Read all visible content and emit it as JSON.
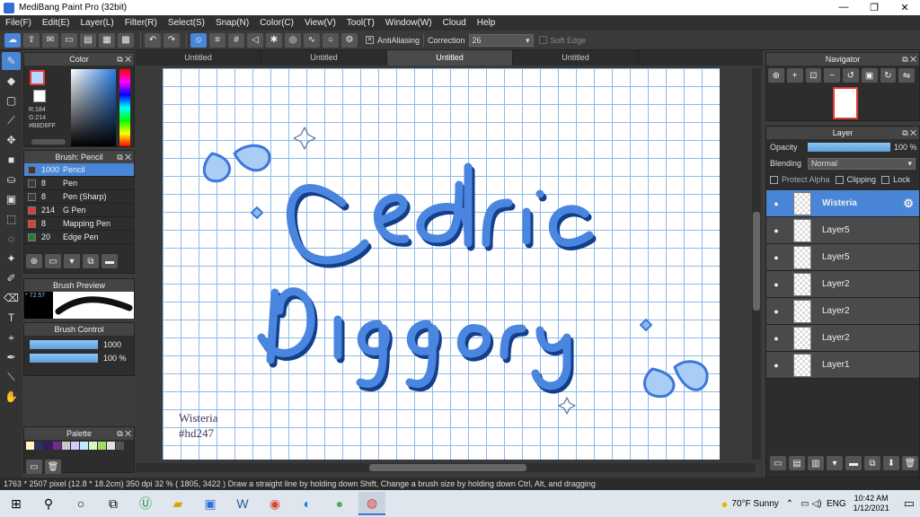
{
  "window": {
    "title": "MediBang Paint Pro (32bit)"
  },
  "menu": [
    "File(F)",
    "Edit(E)",
    "Layer(L)",
    "Filter(R)",
    "Select(S)",
    "Snap(N)",
    "Color(C)",
    "View(V)",
    "Tool(T)",
    "Window(W)",
    "Cloud",
    "Help"
  ],
  "toolbar": {
    "antialias_label": "AntiAliasing",
    "correction_label": "Correction",
    "correction_value": "26",
    "soft_edge_label": "Soft Edge"
  },
  "tabs": [
    "Untitled",
    "Untitled",
    "Untitled",
    "Untitled"
  ],
  "color_panel": {
    "title": "Color",
    "r": "R:184",
    "g": "G:214",
    "hex": "#B8D6FF",
    "foreground": "#b8d6ff"
  },
  "brush_panel": {
    "title": "Brush: Pencil",
    "items": [
      {
        "size": "1000",
        "name": "Pencil",
        "color": "#3a3a3a"
      },
      {
        "size": "8",
        "name": "Pen",
        "color": "#3a3a3a"
      },
      {
        "size": "8",
        "name": "Pen (Sharp)",
        "color": "#3a3a3a"
      },
      {
        "size": "214",
        "name": "G Pen",
        "color": "#e53935"
      },
      {
        "size": "8",
        "name": "Mapping Pen",
        "color": "#e53935"
      },
      {
        "size": "20",
        "name": "Edge Pen",
        "color": "#2e7d32"
      }
    ]
  },
  "preview_panel": {
    "title": "Brush Preview",
    "size": "72.57"
  },
  "control_panel": {
    "title": "Brush Control",
    "size_value": "1000",
    "opacity_value": "100 %",
    "size_fill": 1.0,
    "opacity_fill": 1.0
  },
  "palette_panel": {
    "title": "Palette",
    "colors": [
      "#fff7c2",
      "#2d2d6a",
      "#3a1a5a",
      "#6b2d8f",
      "#c7c7c7",
      "#d9c7ff",
      "#c2e7ff",
      "#d4f5c7",
      "#a5d86a",
      "#e2e2e2",
      "#555555",
      "#2b2b2b"
    ]
  },
  "canvas": {
    "signature_line1": "Wisteria",
    "signature_line2": "#hd247"
  },
  "navigator": {
    "title": "Navigator"
  },
  "layer_panel": {
    "title": "Layer",
    "opacity_label": "Opacity",
    "opacity_value": "100 %",
    "blending_label": "Blending",
    "blending_value": "Normal",
    "protect_alpha": "Protect Alpha",
    "clipping": "Clipping",
    "lock": "Lock",
    "layers": [
      "Wisteria",
      "Layer5",
      "Layer5",
      "Layer2",
      "Layer2",
      "Layer2",
      "Layer1"
    ]
  },
  "status": "1763 * 2507 pixel  (12.8 * 18.2cm)  350 dpi  32 %  ( 1805, 3422 )  Draw a straight line by holding down Shift, Change a brush size by holding down Ctrl, Alt, and dragging",
  "taskbar": {
    "weather_temp": "70°F",
    "weather_desc": "Sunny",
    "lang": "ENG",
    "time": "10:42 AM",
    "date": "1/12/2021"
  }
}
